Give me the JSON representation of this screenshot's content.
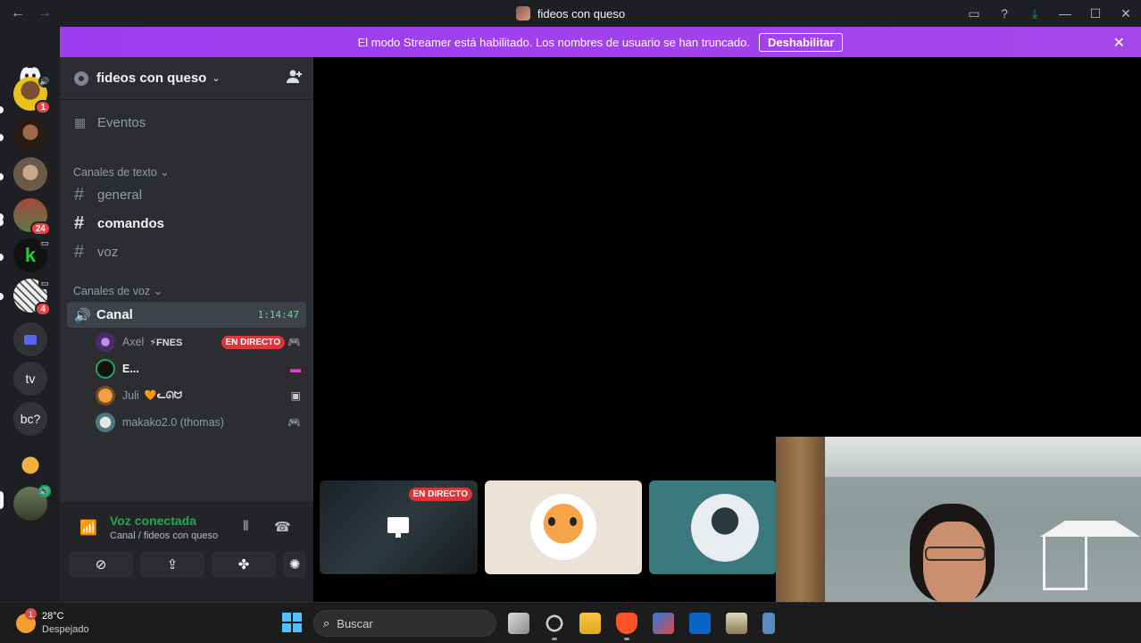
{
  "window": {
    "title": "fideos con queso",
    "nav_back": "←",
    "nav_forward": "→",
    "icons": [
      "inbox-icon",
      "help-icon",
      "download-icon"
    ],
    "controls": [
      "—",
      "☐",
      "✕"
    ]
  },
  "banner": {
    "text": "El modo Streamer está habilitado. Los nombres de usuario se han truncado.",
    "button": "Deshabilitar",
    "close": "✕",
    "color": "#a043ec"
  },
  "servers": [
    {
      "name": "server-1",
      "badge": "1",
      "color": "#e7c21b"
    },
    {
      "name": "server-2",
      "badge": "",
      "color": "#6b3a2a"
    },
    {
      "name": "server-3",
      "badge": "",
      "color": "#d9cfc1"
    },
    {
      "name": "server-4",
      "badge": "24",
      "color": "#5c7a4c"
    },
    {
      "name": "server-5",
      "badge": "",
      "color": "#18a83a"
    },
    {
      "name": "server-6",
      "badge": "4",
      "color": "#c9c9c9"
    },
    {
      "name": "server-folder",
      "badge": "",
      "color": "#5865f2"
    },
    {
      "name": "server-tv",
      "label": "tv"
    },
    {
      "name": "server-bc",
      "label": "bc?"
    },
    {
      "name": "server-10",
      "badge": "",
      "color": "#d68a2a"
    },
    {
      "name": "server-11",
      "badge": "",
      "color": "#6a7a5a"
    }
  ],
  "guild": {
    "name": "fideos con queso",
    "events": "Eventos",
    "text_category": "Canales de texto",
    "text_channels": [
      "general",
      "comandos",
      "voz"
    ],
    "voice_category": "Canales de voz",
    "voice_channel": "Canal",
    "voice_time": "1:14:47",
    "voice_users": [
      {
        "name": "Axel",
        "tag": "⚡FNES",
        "live": "EN DIRECTO",
        "color": "#6a4a8a"
      },
      {
        "name": "E...",
        "tag": "",
        "live": "",
        "color": "#b02030"
      },
      {
        "name": "Juli",
        "tag": "🧡ᓚᘏᗢ",
        "live": "",
        "color": "#e09040"
      },
      {
        "name": "makako2.0 (thomas)",
        "tag": "",
        "live": "",
        "color": "#6a9aa0"
      }
    ]
  },
  "voice_panel": {
    "status": "Voz conectada",
    "location": "Canal / fideos con queso"
  },
  "stage": {
    "tile_live_label": "EN DIRECTO"
  },
  "taskbar": {
    "weather_temp": "28°C",
    "weather_cond": "Despejado",
    "weather_badge": "1",
    "search_placeholder": "Buscar"
  },
  "colors": {
    "accent_green": "#23a55a",
    "live_red": "#da373c",
    "sidebar": "#2b2d31",
    "rail": "#1e1f22"
  }
}
